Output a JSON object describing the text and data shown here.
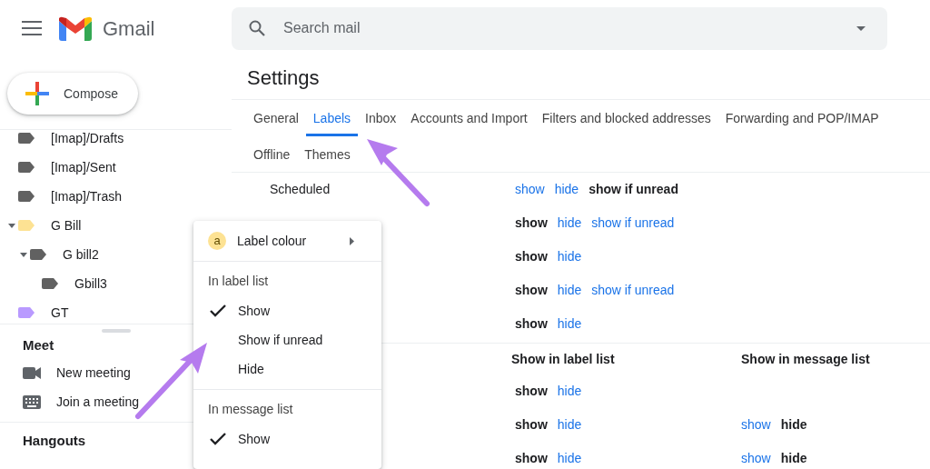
{
  "header": {
    "app_name": "Gmail",
    "search": {
      "placeholder": "Search mail"
    }
  },
  "sidebar": {
    "compose": "Compose",
    "labels": [
      {
        "name": "[Imap]/Drafts",
        "color": "#616161"
      },
      {
        "name": "[Imap]/Sent",
        "color": "#616161"
      },
      {
        "name": "[Imap]/Trash",
        "color": "#616161"
      },
      {
        "name": "G Bill",
        "color": "#fde293",
        "expanded": true,
        "children": [
          {
            "name": "G bill2",
            "color": "#616161",
            "expanded": true,
            "children": [
              {
                "name": "Gbill3",
                "color": "#616161"
              }
            ]
          }
        ]
      },
      {
        "name": "GT",
        "color": "#b99aff"
      }
    ],
    "meet": {
      "title": "Meet",
      "items": [
        {
          "label": "New meeting",
          "kind": "video"
        },
        {
          "label": "Join a meeting",
          "kind": "keyboard"
        }
      ]
    },
    "hangouts": {
      "title": "Hangouts"
    }
  },
  "settings": {
    "title": "Settings",
    "tabs": [
      {
        "label": "General",
        "selected": false
      },
      {
        "label": "Labels",
        "selected": true
      },
      {
        "label": "Inbox",
        "selected": false
      },
      {
        "label": "Accounts and Import",
        "selected": false
      },
      {
        "label": "Filters and blocked addresses",
        "selected": false
      },
      {
        "label": "Forwarding and POP/IMAP",
        "selected": false
      },
      {
        "label": "Offline",
        "selected": false
      },
      {
        "label": "Themes",
        "selected": false
      }
    ],
    "system_labels": [
      {
        "name": "Scheduled",
        "options": [
          {
            "text": "show",
            "selected": false
          },
          {
            "text": "hide",
            "selected": false
          },
          {
            "text": "show if unread",
            "selected": true
          }
        ]
      },
      {
        "options": [
          {
            "text": "show",
            "selected": true
          },
          {
            "text": "hide",
            "selected": false
          },
          {
            "text": "show if unread",
            "selected": false
          }
        ]
      },
      {
        "options": [
          {
            "text": "show",
            "selected": true
          },
          {
            "text": "hide",
            "selected": false
          }
        ]
      },
      {
        "options": [
          {
            "text": "show",
            "selected": true
          },
          {
            "text": "hide",
            "selected": false
          },
          {
            "text": "show if unread",
            "selected": false
          }
        ]
      },
      {
        "options": [
          {
            "text": "show",
            "selected": true
          },
          {
            "text": "hide",
            "selected": false
          }
        ]
      }
    ],
    "label_columns": [
      "Show in label list",
      "Show in message list"
    ],
    "label_rows": [
      {
        "label_list": [
          {
            "text": "show",
            "selected": true
          },
          {
            "text": "hide",
            "selected": false
          }
        ]
      },
      {
        "label_list": [
          {
            "text": "show",
            "selected": true
          },
          {
            "text": "hide",
            "selected": false
          }
        ],
        "message_list": [
          {
            "text": "show",
            "selected": false
          },
          {
            "text": "hide",
            "selected": true
          }
        ]
      },
      {
        "label_list": [
          {
            "text": "show",
            "selected": true
          },
          {
            "text": "hide",
            "selected": false
          }
        ],
        "message_list": [
          {
            "text": "show",
            "selected": false
          },
          {
            "text": "hide",
            "selected": true
          }
        ]
      }
    ]
  },
  "menu": {
    "color_item": {
      "avatar": "a",
      "label": "Label colour"
    },
    "sections": [
      {
        "title": "In label list",
        "items": [
          {
            "label": "Show",
            "checked": true
          },
          {
            "label": "Show if unread",
            "checked": false
          },
          {
            "label": "Hide",
            "checked": false
          }
        ]
      },
      {
        "title": "In message list",
        "items": [
          {
            "label": "Show",
            "checked": true
          }
        ]
      }
    ]
  }
}
